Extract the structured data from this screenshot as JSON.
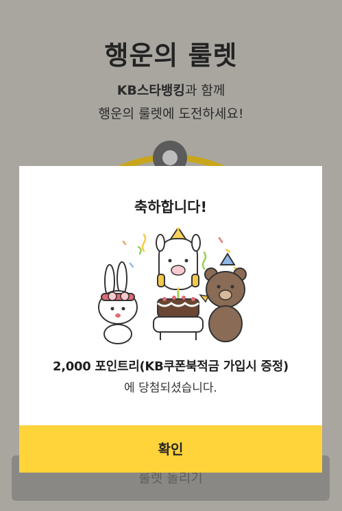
{
  "background": {
    "title": "행운의 룰렛",
    "subtitle_brand": "KB스타뱅킹",
    "subtitle_rest": "과 함께",
    "subtitle_line2": "행운의 룰렛에 도전하세요!",
    "spin_button": "룰렛 돌리기"
  },
  "modal": {
    "title": "축하합니다!",
    "prize": "2,000 포인트리(KB쿠폰북적금 가입시 증정)",
    "message": "에 당첨되셨습니다.",
    "confirm": "확인"
  },
  "colors": {
    "accent": "#ffd43a",
    "dim_overlay": "#a8a69f"
  }
}
